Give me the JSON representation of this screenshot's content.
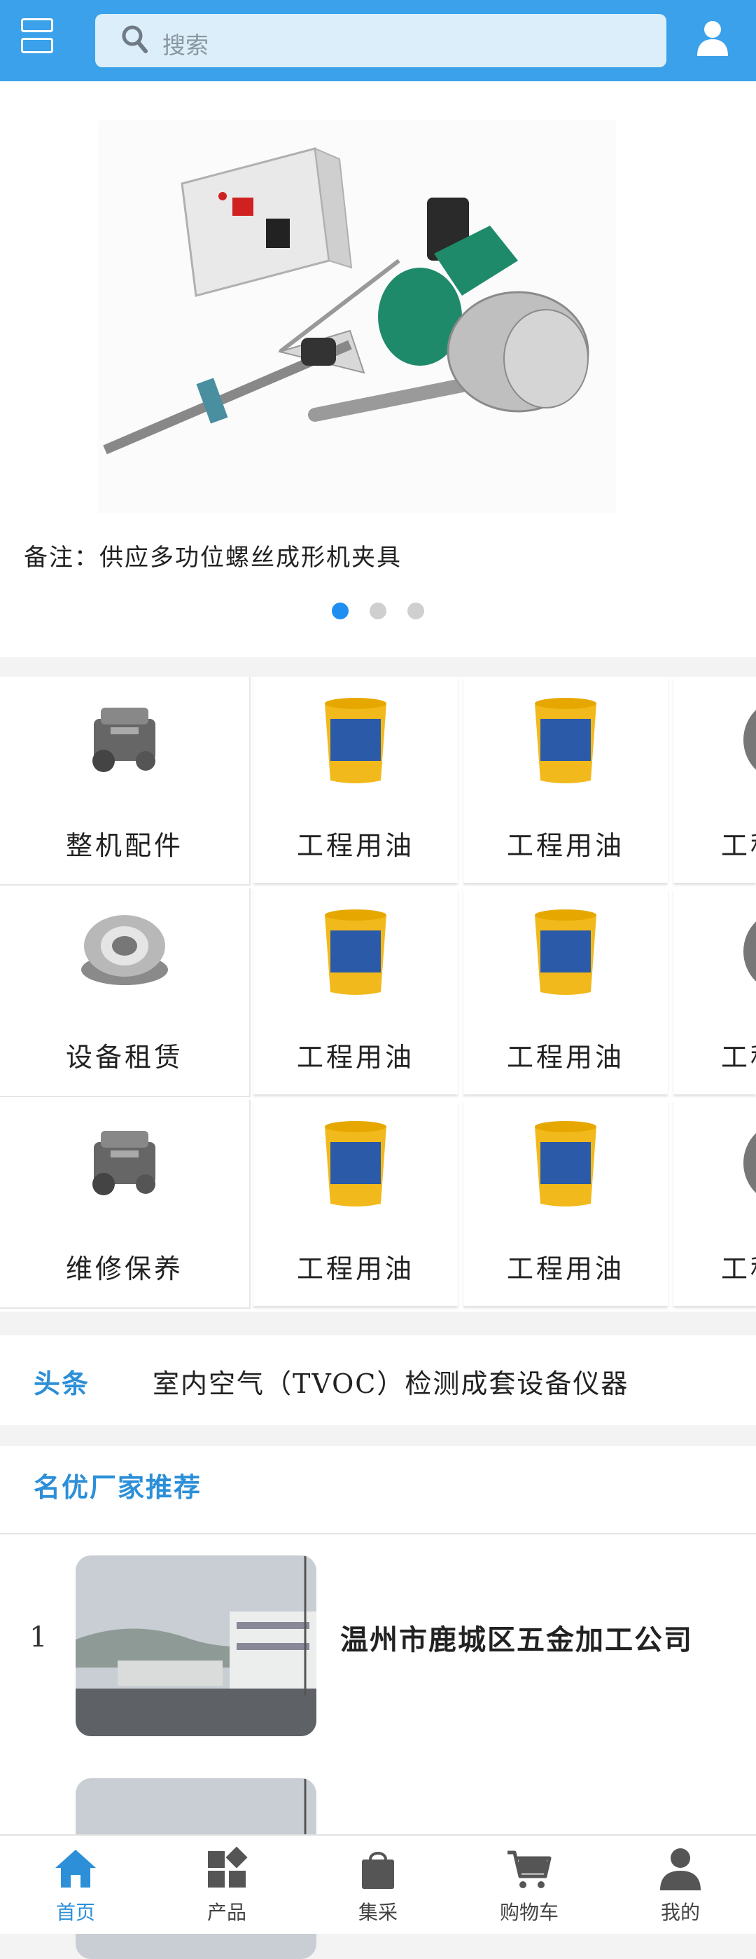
{
  "search": {
    "placeholder": "搜索"
  },
  "banner": {
    "caption": "备注：供应多功位螺丝成形机夹具",
    "dot_count": 3,
    "active_dot": 0
  },
  "categories": [
    {
      "label": "整机配件",
      "icon": "engine-icon"
    },
    {
      "label": "设备租赁",
      "icon": "bearing-icon"
    },
    {
      "label": "维修保养",
      "icon": "engine-icon"
    }
  ],
  "products": [
    [
      "工程用油",
      "工程用油",
      "工程"
    ],
    [
      "工程用油",
      "工程用油",
      "工程"
    ],
    [
      "工程用油",
      "工程用油",
      "工程"
    ]
  ],
  "headline": {
    "tag": "头条",
    "text": "室内空气（TVOC）检测成套设备仪器"
  },
  "recommend": {
    "title": "名优厂家推荐",
    "items": [
      {
        "rank": "1",
        "name": "温州市鹿城区五金加工公司"
      }
    ]
  },
  "tabbar": [
    {
      "label": "首页",
      "icon": "home-icon",
      "active": true
    },
    {
      "label": "产品",
      "icon": "apps-icon",
      "active": false
    },
    {
      "label": "集采",
      "icon": "bag-icon",
      "active": false
    },
    {
      "label": "购物车",
      "icon": "cart-icon",
      "active": false
    },
    {
      "label": "我的",
      "icon": "user-icon",
      "active": false
    }
  ],
  "colors": {
    "primary": "#3aa1ea",
    "accent": "#2c8fd8",
    "dot_active": "#1e8ff0"
  }
}
